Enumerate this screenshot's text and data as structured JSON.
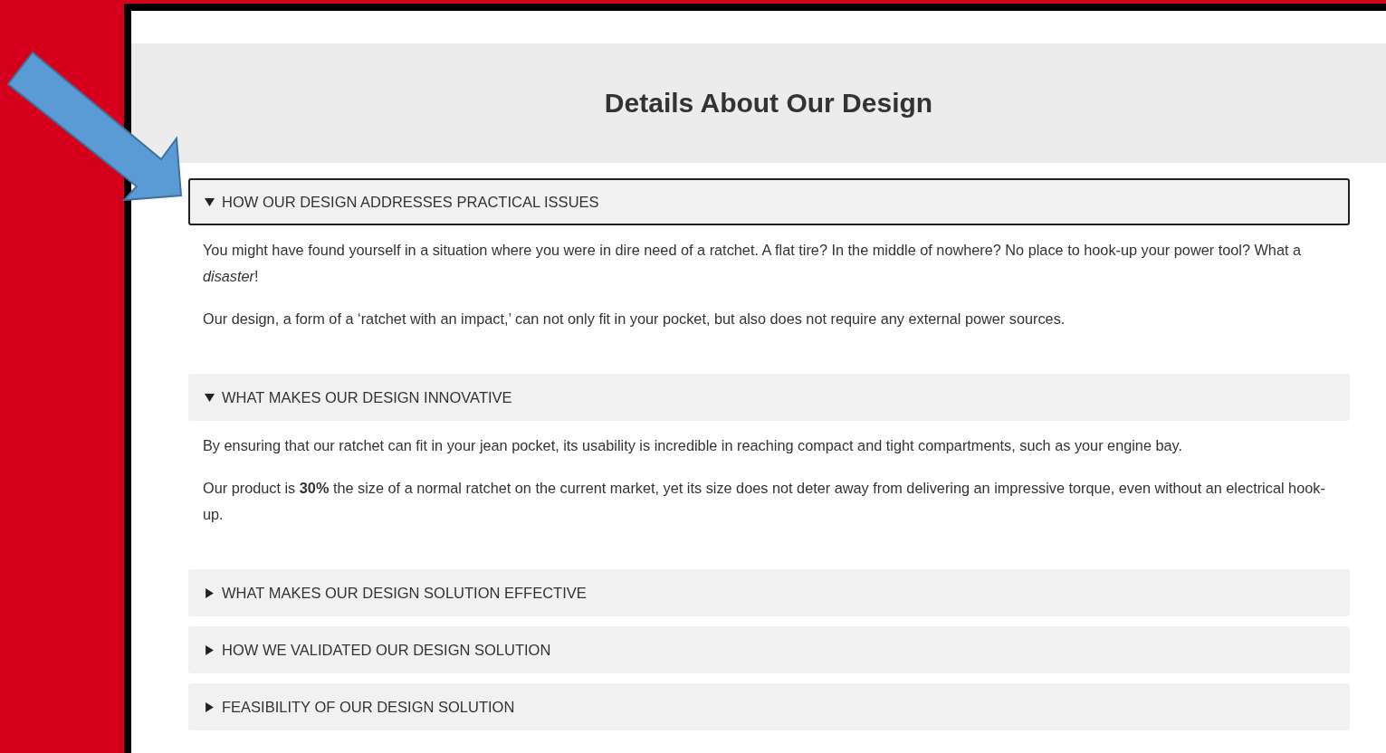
{
  "page": {
    "title": "Details About Our Design"
  },
  "sections": [
    {
      "title": "HOW OUR DESIGN ADDRESSES PRACTICAL ISSUES",
      "expanded": true,
      "focused": true,
      "paragraphs": [
        "You might have found yourself in a situation where you were in dire need of a ratchet. A flat tire? In the middle of nowhere? No place to hook-up your power tool? What a *disaster*!",
        "Our design, a form of a ‘ratchet with an impact,’ can not only fit in your pocket, but also does not require any external power sources."
      ]
    },
    {
      "title": "WHAT MAKES OUR DESIGN INNOVATIVE",
      "expanded": true,
      "focused": false,
      "paragraphs": [
        "By ensuring that our ratchet can fit in your jean pocket, its usability is incredible in reaching compact and tight compartments, such as your engine bay.",
        "Our product is **30%** the size of a normal ratchet on the current market, yet its size does not deter away from delivering an impressive torque, even without an electrical hook-up."
      ]
    },
    {
      "title": "WHAT MAKES OUR DESIGN SOLUTION EFFECTIVE",
      "expanded": false,
      "focused": false
    },
    {
      "title": "HOW WE VALIDATED OUR DESIGN SOLUTION",
      "expanded": false,
      "focused": false
    },
    {
      "title": "FEASIBILITY OF OUR DESIGN SOLUTION",
      "expanded": false,
      "focused": false
    }
  ]
}
